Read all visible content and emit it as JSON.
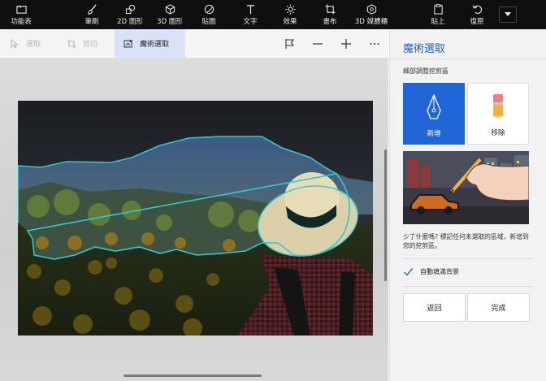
{
  "ribbon": {
    "menu_label": "功能表",
    "brushes": "筆刷",
    "shapes_2d": "2D 圖形",
    "shapes_3d": "3D 圖形",
    "stickers": "貼圖",
    "text": "文字",
    "effects": "效果",
    "canvas": "畫布",
    "library_3d": "3D 媒體櫃",
    "paste": "貼上",
    "undo": "復原"
  },
  "toolbar": {
    "select": "選取",
    "crop": "剪切",
    "magic_select": "魔術選取"
  },
  "panel": {
    "title": "魔術選取",
    "subtitle": "細部調整挖剪區",
    "add_label": "新增",
    "remove_label": "移除",
    "tip": "少了什麼嗎? 標記任何未選取的區域，新增到您的挖剪區。",
    "autofill_label": "自動填滿背景",
    "autofill_checked": true,
    "back_button": "返回",
    "done_button": "完成"
  },
  "colors": {
    "accent": "#2166d9",
    "title_blue": "#1f5fd6",
    "ribbon_bg": "#0f0f0f",
    "selection_outline": "#2ecad0"
  }
}
